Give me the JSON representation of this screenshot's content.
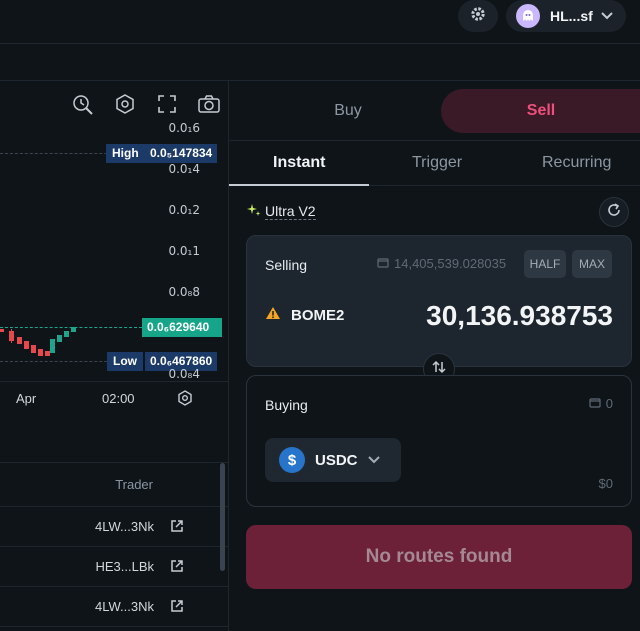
{
  "header": {
    "account_label": "HL...sf",
    "icons": [
      "gear-icon",
      "ghost-avatar-icon",
      "chevron-down-icon"
    ]
  },
  "chart": {
    "tool_icons": [
      "pencil-clock-icon",
      "hexagon-settings-icon",
      "fullscreen-icon",
      "camera-icon"
    ],
    "price_ticks": [
      "0.0₁6",
      "0.0₁4",
      "0.0₁2",
      "0.0₁1",
      "0.0₈8",
      "0.0₈4"
    ],
    "high_label": "High",
    "high_value": "0.0₅147834",
    "current_value": "0.0₆629640",
    "low_label": "Low",
    "low_value": "0.0₆467860",
    "time_ticks": [
      "Apr",
      "02:00"
    ],
    "colors": {
      "up": "#1fa38a",
      "down": "#e5484d",
      "tag_bg": "#1c3a68",
      "current_bg": "#17a589"
    }
  },
  "trades": {
    "trader_header": "Trader",
    "rows": [
      {
        "trader": "4LW...3Nk"
      },
      {
        "trader": "HE3...LBk"
      },
      {
        "trader": "4LW...3Nk"
      }
    ]
  },
  "swap": {
    "buy_tab": "Buy",
    "sell_tab": "Sell",
    "modes": [
      "Instant",
      "Trigger",
      "Recurring"
    ],
    "active_mode": "Instant",
    "ultra_label": "Ultra V2",
    "selling": {
      "title": "Selling",
      "balance": "14,405,539.028035",
      "half_label": "HALF",
      "max_label": "MAX",
      "token": "BOME2",
      "amount": "30,136.938753"
    },
    "buying": {
      "title": "Buying",
      "balance": "0",
      "token": "USDC",
      "usd_value": "$0"
    },
    "submit_label": "No routes found",
    "colors": {
      "sell_accent": "#ef4f7d",
      "submit_bg": "#6d2139"
    }
  }
}
